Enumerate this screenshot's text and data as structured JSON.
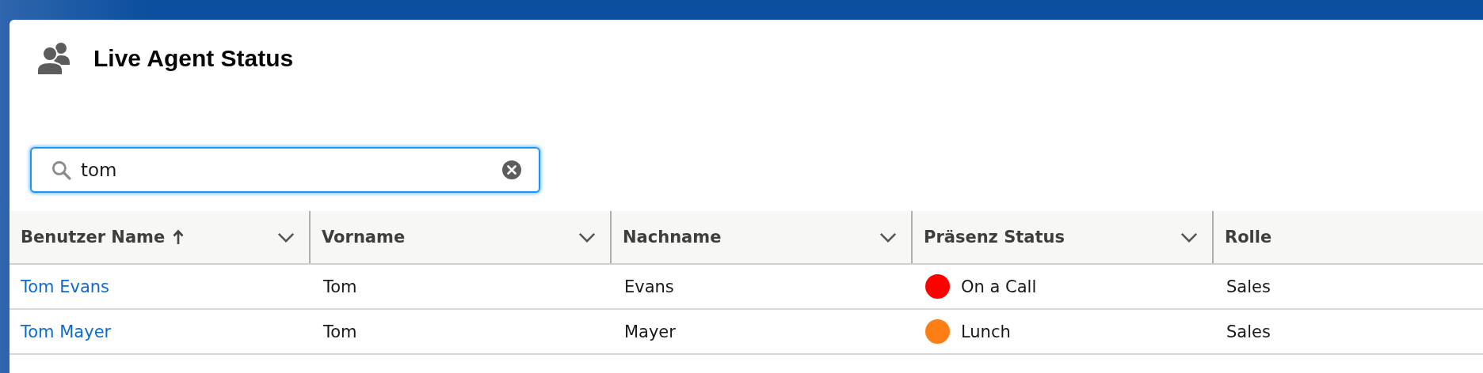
{
  "card": {
    "title": "Live Agent Status"
  },
  "search": {
    "value": "tom",
    "focused": true
  },
  "table": {
    "columns": [
      {
        "label": "Benutzer Name",
        "sorted": true,
        "menu": true
      },
      {
        "label": "Vorname",
        "sorted": false,
        "menu": true
      },
      {
        "label": "Nachname",
        "sorted": false,
        "menu": true
      },
      {
        "label": "Präsenz Status",
        "sorted": false,
        "menu": true
      },
      {
        "label": "Rolle",
        "sorted": false
      }
    ],
    "rows": [
      {
        "user_name": "Tom Evans",
        "first_name": "Tom",
        "last_name": "Evans",
        "status": {
          "label": "On a Call",
          "color": "#ff0000"
        },
        "role": "Sales"
      },
      {
        "user_name": "Tom Mayer",
        "first_name": "Tom",
        "last_name": "Mayer",
        "status": {
          "label": "Lunch",
          "color": "#fd7e14"
        },
        "role": "Sales"
      }
    ]
  }
}
